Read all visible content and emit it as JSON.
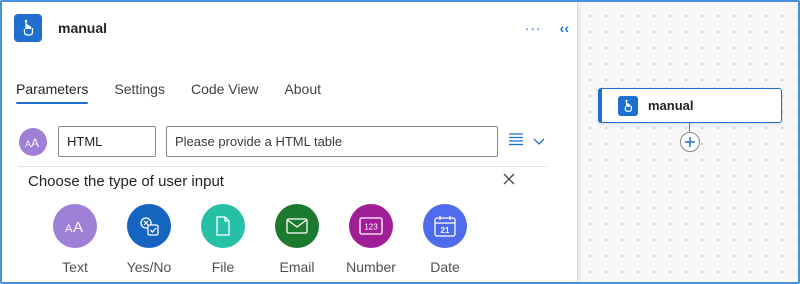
{
  "panel": {
    "title": "manual",
    "more_label": "···",
    "collapse_label": "‹‹",
    "tabs": [
      {
        "label": "Parameters",
        "active": true
      },
      {
        "label": "Settings",
        "active": false
      },
      {
        "label": "Code View",
        "active": false
      },
      {
        "label": "About",
        "active": false
      }
    ],
    "input_row": {
      "avatar_text": "AA",
      "name_value": "HTML",
      "description_value": "Please provide a HTML table"
    },
    "choose": {
      "title": "Choose the type of user input",
      "options": [
        {
          "label": "Text",
          "color": "#a07fd6",
          "icon": "text-icon"
        },
        {
          "label": "Yes/No",
          "color": "#1565c0",
          "icon": "yes-no-icon"
        },
        {
          "label": "File",
          "color": "#26c0a7",
          "icon": "file-icon"
        },
        {
          "label": "Email",
          "color": "#1b7a2e",
          "icon": "email-icon"
        },
        {
          "label": "Number",
          "color": "#a01e96",
          "icon": "number-icon"
        },
        {
          "label": "Date",
          "color": "#4f6bed",
          "icon": "date-icon"
        }
      ],
      "number_icon_text": "123",
      "date_icon_text": "21"
    }
  },
  "canvas": {
    "node_label": "manual"
  },
  "colors": {
    "accent": "#1f6fd1",
    "frame_border": "#4a90d9"
  }
}
